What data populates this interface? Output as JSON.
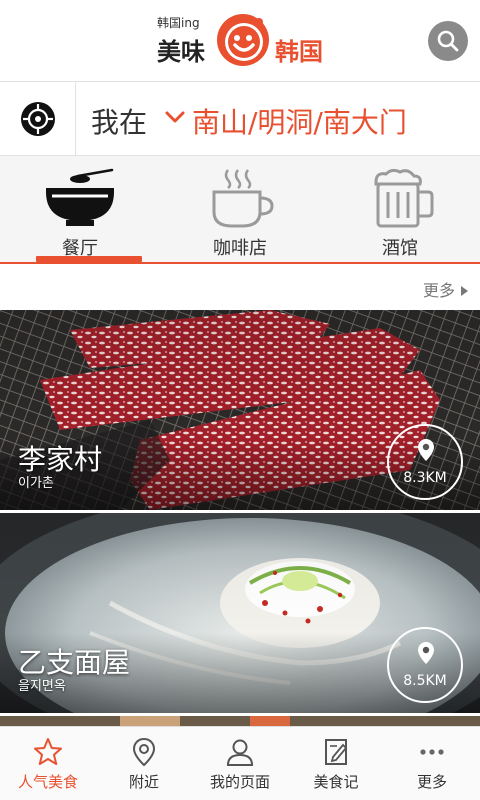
{
  "header": {
    "logo_small": "韩国ing",
    "logo_main": "美味",
    "logo_accent": "韩国"
  },
  "location": {
    "label": "我在",
    "value": "南山/明洞/南大门"
  },
  "categories": [
    {
      "label": "餐厅",
      "icon": "bowl-icon",
      "active": true
    },
    {
      "label": "咖啡店",
      "icon": "coffee-cup-icon",
      "active": false
    },
    {
      "label": "酒馆",
      "icon": "beer-mug-icon",
      "active": false
    }
  ],
  "more": {
    "label": "更多"
  },
  "restaurants": [
    {
      "name": "李家村",
      "subtitle": "이가촌",
      "distance": "8.3KM"
    },
    {
      "name": "乙支面屋",
      "subtitle": "을지면옥",
      "distance": "8.5KM"
    }
  ],
  "bottom_nav": [
    {
      "label": "人气美食",
      "icon": "star-icon",
      "active": true
    },
    {
      "label": "附近",
      "icon": "location-pin-icon",
      "active": false
    },
    {
      "label": "我的页面",
      "icon": "person-icon",
      "active": false
    },
    {
      "label": "美食记",
      "icon": "notes-icon",
      "active": false
    },
    {
      "label": "更多",
      "icon": "more-dots-icon",
      "active": false
    }
  ],
  "colors": {
    "accent": "#e8502f",
    "icon_gray": "#9a9a9a"
  }
}
